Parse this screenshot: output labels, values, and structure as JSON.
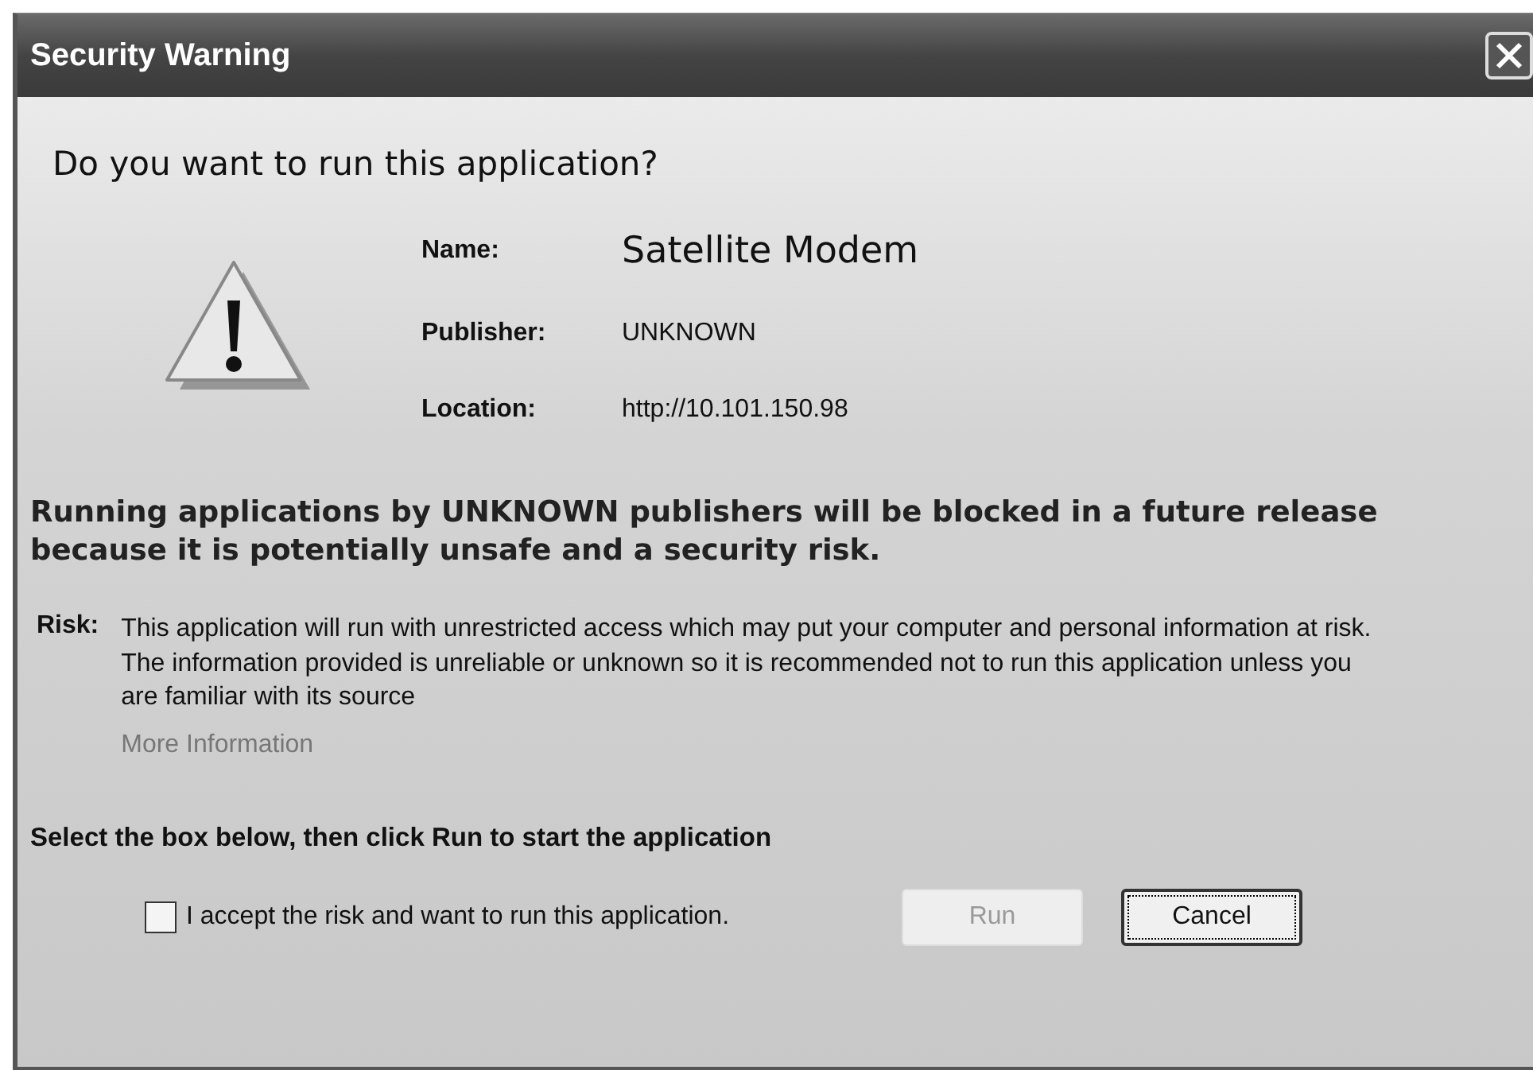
{
  "window": {
    "title": "Security Warning"
  },
  "heading": "Do you want to run this application?",
  "details": [
    {
      "label": "Name:",
      "value": "Satellite Modem",
      "kind": "large"
    },
    {
      "label": "Publisher:",
      "value": "UNKNOWN",
      "kind": "normal"
    },
    {
      "label": "Location:",
      "value": "http://10.101.150.98",
      "kind": "normal"
    }
  ],
  "warning": "Running applications by UNKNOWN publishers will be blocked in a future release because it is potentially unsafe and a security risk.",
  "risk": {
    "label": "Risk:",
    "text": "This application will run with unrestricted access which may put your computer and personal information at risk. The information provided is unreliable or unknown so it is recommended not to run this application unless you are familiar with its source",
    "link": "More Information"
  },
  "instruction": "Select the box below, then click Run to start the application",
  "accept": {
    "label": "I accept the risk and want to run this application.",
    "checked": false
  },
  "buttons": [
    {
      "label": "Run",
      "disabled": true,
      "focused": false
    },
    {
      "label": "Cancel",
      "disabled": false,
      "focused": true
    }
  ]
}
